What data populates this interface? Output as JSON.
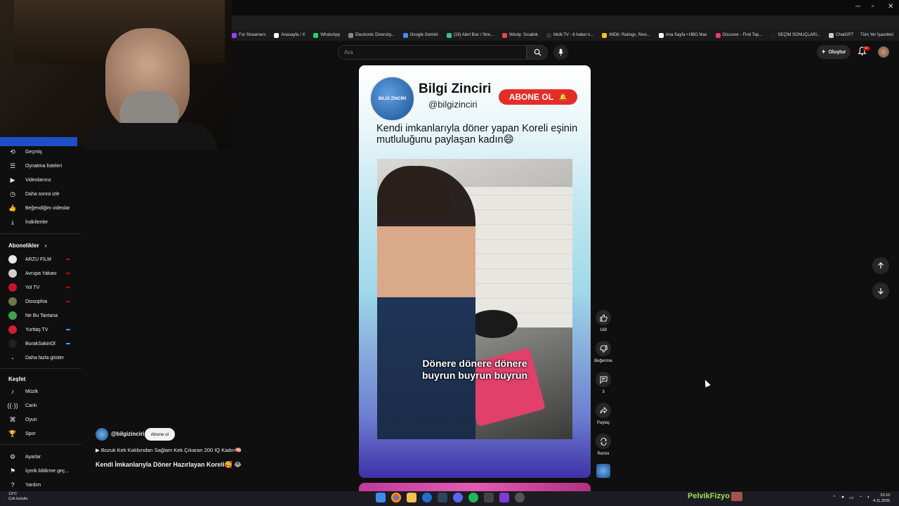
{
  "bookmarks": [
    {
      "label": "For Streamers",
      "color": "#9146ff"
    },
    {
      "label": "Anasayfa / X",
      "color": "#ffffff"
    },
    {
      "label": "WhatsApp",
      "color": "#25d366"
    },
    {
      "label": "Electronic Diversity...",
      "color": "#888888"
    },
    {
      "label": "Google Gemini",
      "color": "#4a8af4"
    },
    {
      "label": "(19) Alert Box / Stre...",
      "color": "#31c3a2"
    },
    {
      "label": "Windy: Sıcaklık",
      "color": "#e24a4a"
    },
    {
      "label": "Multi TV - 6 haber k...",
      "color": "#333333"
    },
    {
      "label": "IMDb: Ratings, Revi...",
      "color": "#f5c518"
    },
    {
      "label": "Ana Sayfa • HBO Max",
      "color": "#ffffff"
    },
    {
      "label": "Discover - Find Top...",
      "color": "#e6397c"
    },
    {
      "label": "SEÇİM SONUÇLARI...",
      "color": "#222222"
    },
    {
      "label": "ChatGPT",
      "color": "#cccccc"
    }
  ],
  "bookmarks_all": "Tüm Yer İşaretleri",
  "search": {
    "placeholder": "Ara"
  },
  "header": {
    "create_label": "Oluştur",
    "notifications_badge": "9+"
  },
  "sidebar": {
    "you_items": [
      {
        "label": "Geçmiş",
        "icon": "history-icon"
      },
      {
        "label": "Oynatma listeleri",
        "icon": "playlist-icon"
      },
      {
        "label": "Videolarınız",
        "icon": "video-icon"
      },
      {
        "label": "Daha sonra izle",
        "icon": "clock-icon"
      },
      {
        "label": "Beğendiğim videolar",
        "icon": "thumbs-up-icon"
      },
      {
        "label": "İndirilenler",
        "icon": "download-icon"
      }
    ],
    "subscriptions_title": "Abonelikler",
    "subscriptions": [
      {
        "label": "ARZU FİLM",
        "color": "#e8e8e8",
        "dot": "#cc0000"
      },
      {
        "label": "Avrupa Yakası",
        "color": "#d0d0d0",
        "dot": "#cc0000"
      },
      {
        "label": "Yol TV",
        "color": "#c8102e",
        "dot": "#cc0000"
      },
      {
        "label": "Diosophia",
        "color": "#6a7b4a",
        "dot": "#cc0000"
      },
      {
        "label": "Ne Bu Tantana",
        "color": "#3fa34d",
        "dot": ""
      },
      {
        "label": "Yurttaş TV",
        "color": "#d02030",
        "dot": "#3ea6ff"
      },
      {
        "label": "BurakSakinOl",
        "color": "#222222",
        "dot": "#3ea6ff"
      }
    ],
    "show_more": "Daha fazla göster",
    "explore_title": "Keşfet",
    "explore": [
      {
        "label": "Müzik",
        "icon": "music-icon"
      },
      {
        "label": "Canlı",
        "icon": "live-icon"
      },
      {
        "label": "Oyun",
        "icon": "gaming-icon"
      },
      {
        "label": "Spor",
        "icon": "trophy-icon"
      }
    ],
    "bottom": [
      {
        "label": "Ayarlar",
        "icon": "gear-icon"
      },
      {
        "label": "İçerik bildirme geç...",
        "icon": "flag-icon"
      },
      {
        "label": "Yardım",
        "icon": "help-icon"
      }
    ]
  },
  "short": {
    "brand": "Bilgi Zinciri",
    "handle": "@bilgizinciri",
    "subscribe": "ABONE OL",
    "caption": "Kendi imkanlarıyla döner yapan Koreli eşinin mutluluğunu paylaşan kadın😄",
    "subtitle_line1": "Dönere dönere dönere",
    "subtitle_line2": "buyrun buyrun buyrun",
    "logo_text": "BİLGİ ZİNCİRİ"
  },
  "actions": {
    "likes": "169",
    "dislike_label": "Beğenme",
    "comments": "3",
    "share_label": "Paylaş",
    "remix_label": "Remix"
  },
  "channel": {
    "name": "@bilgizinciri",
    "subscribe": "Abone ol",
    "related": "▶ Bozuk Kek Kalıbından Sağlam Kek Çıkaran 200 IQ Kadın🧠",
    "title": "Kendi İmkanlarıyla Döner Hazırlayan Koreli🥰 😂"
  },
  "taskbar": {
    "weather_temp": "13°C",
    "weather_desc": "Çok bulutlu",
    "brand": "PelvikFizyo",
    "time": "23:10",
    "date": "4.11.2025"
  }
}
